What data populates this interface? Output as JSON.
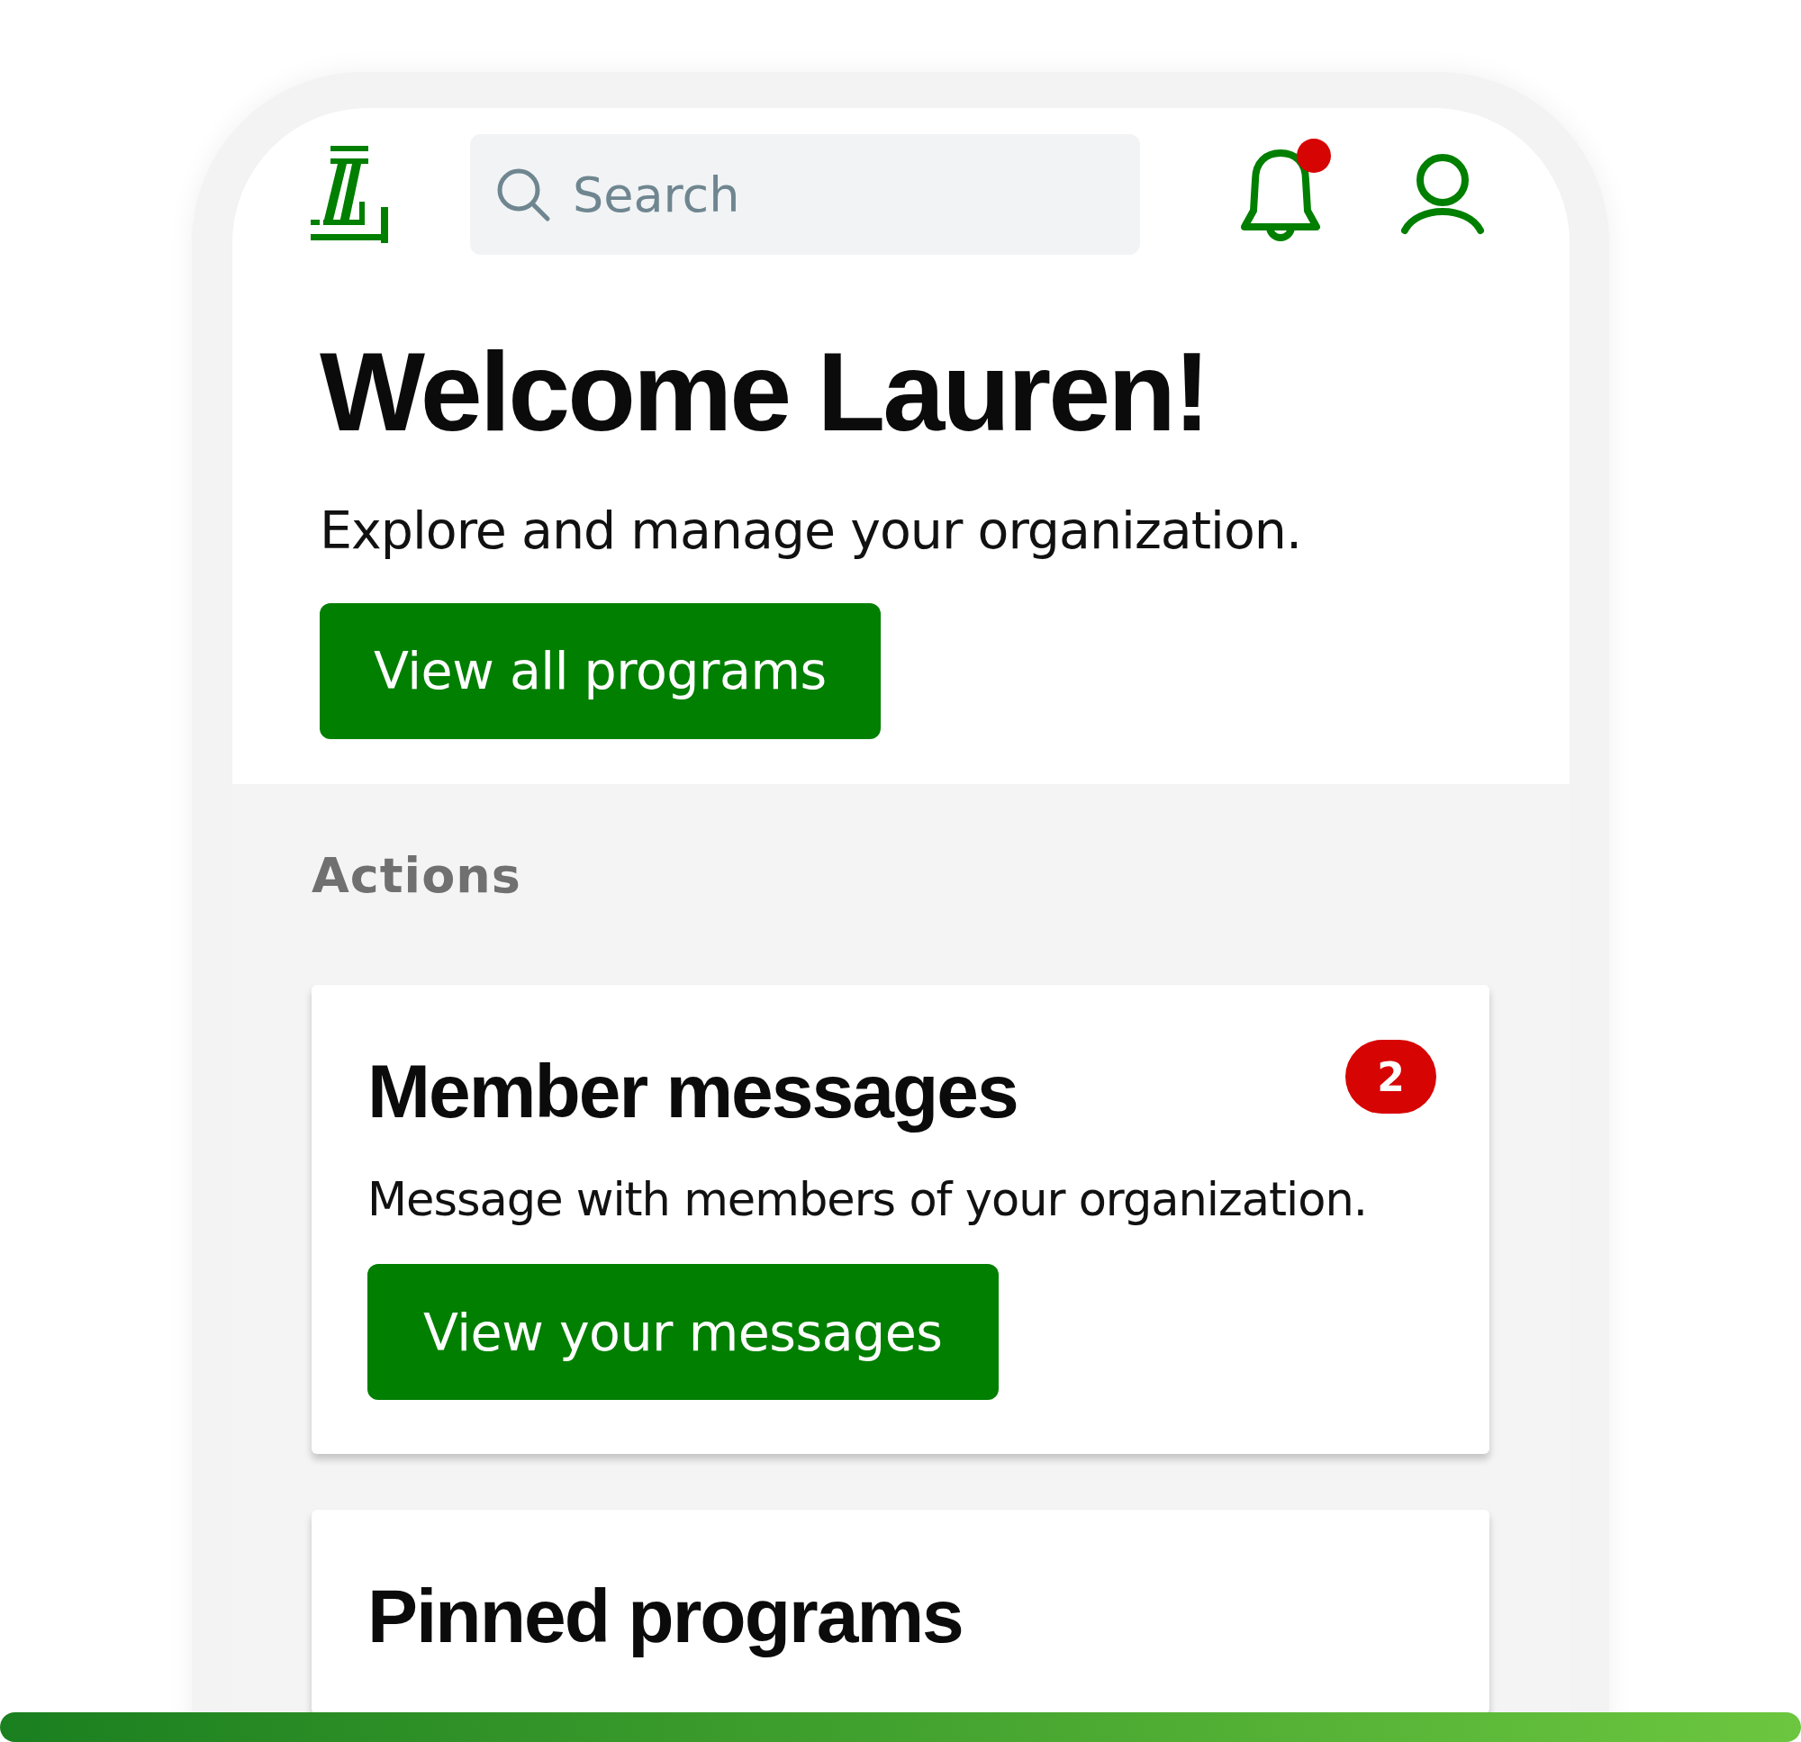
{
  "header": {
    "search": {
      "placeholder": "Search"
    },
    "notifications": {
      "unread": true
    }
  },
  "welcome": {
    "title": "Welcome Lauren!",
    "subtitle": "Explore and manage your organization.",
    "button": "View all programs"
  },
  "actions": {
    "heading": "Actions",
    "cards": [
      {
        "title": "Member messages",
        "badge": "2",
        "description": "Message with members of your organization.",
        "button": "View your messages"
      },
      {
        "title": "Pinned programs"
      }
    ]
  }
}
